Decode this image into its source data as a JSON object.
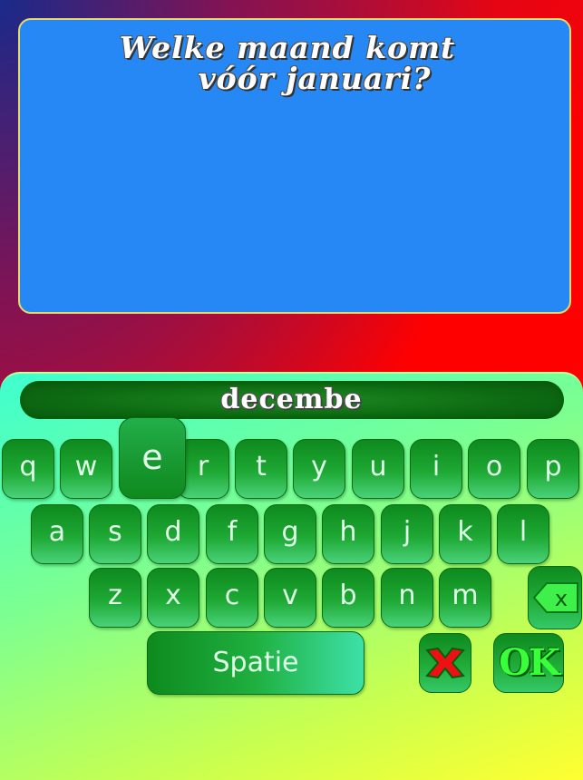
{
  "question": {
    "line1": "Welke maand komt",
    "line2": "vóór januari?"
  },
  "answer": {
    "text": "decembe"
  },
  "keyboard": {
    "row1": [
      "q",
      "w",
      "e",
      "r",
      "t",
      "y",
      "u",
      "i",
      "o",
      "p"
    ],
    "row2": [
      "a",
      "s",
      "d",
      "f",
      "g",
      "h",
      "j",
      "k",
      "l"
    ],
    "row3": [
      "z",
      "x",
      "c",
      "v",
      "b",
      "n",
      "m"
    ],
    "pressed_key": "e",
    "space_label": "Spatie",
    "ok_label": "OK"
  },
  "colors": {
    "question_panel": "#2688f4",
    "key_green": "#1ea834",
    "cancel_red": "#ee1111",
    "ok_green": "#38ff3a"
  },
  "icons": {
    "backspace": "backspace-icon",
    "cancel": "cancel-x-icon"
  }
}
